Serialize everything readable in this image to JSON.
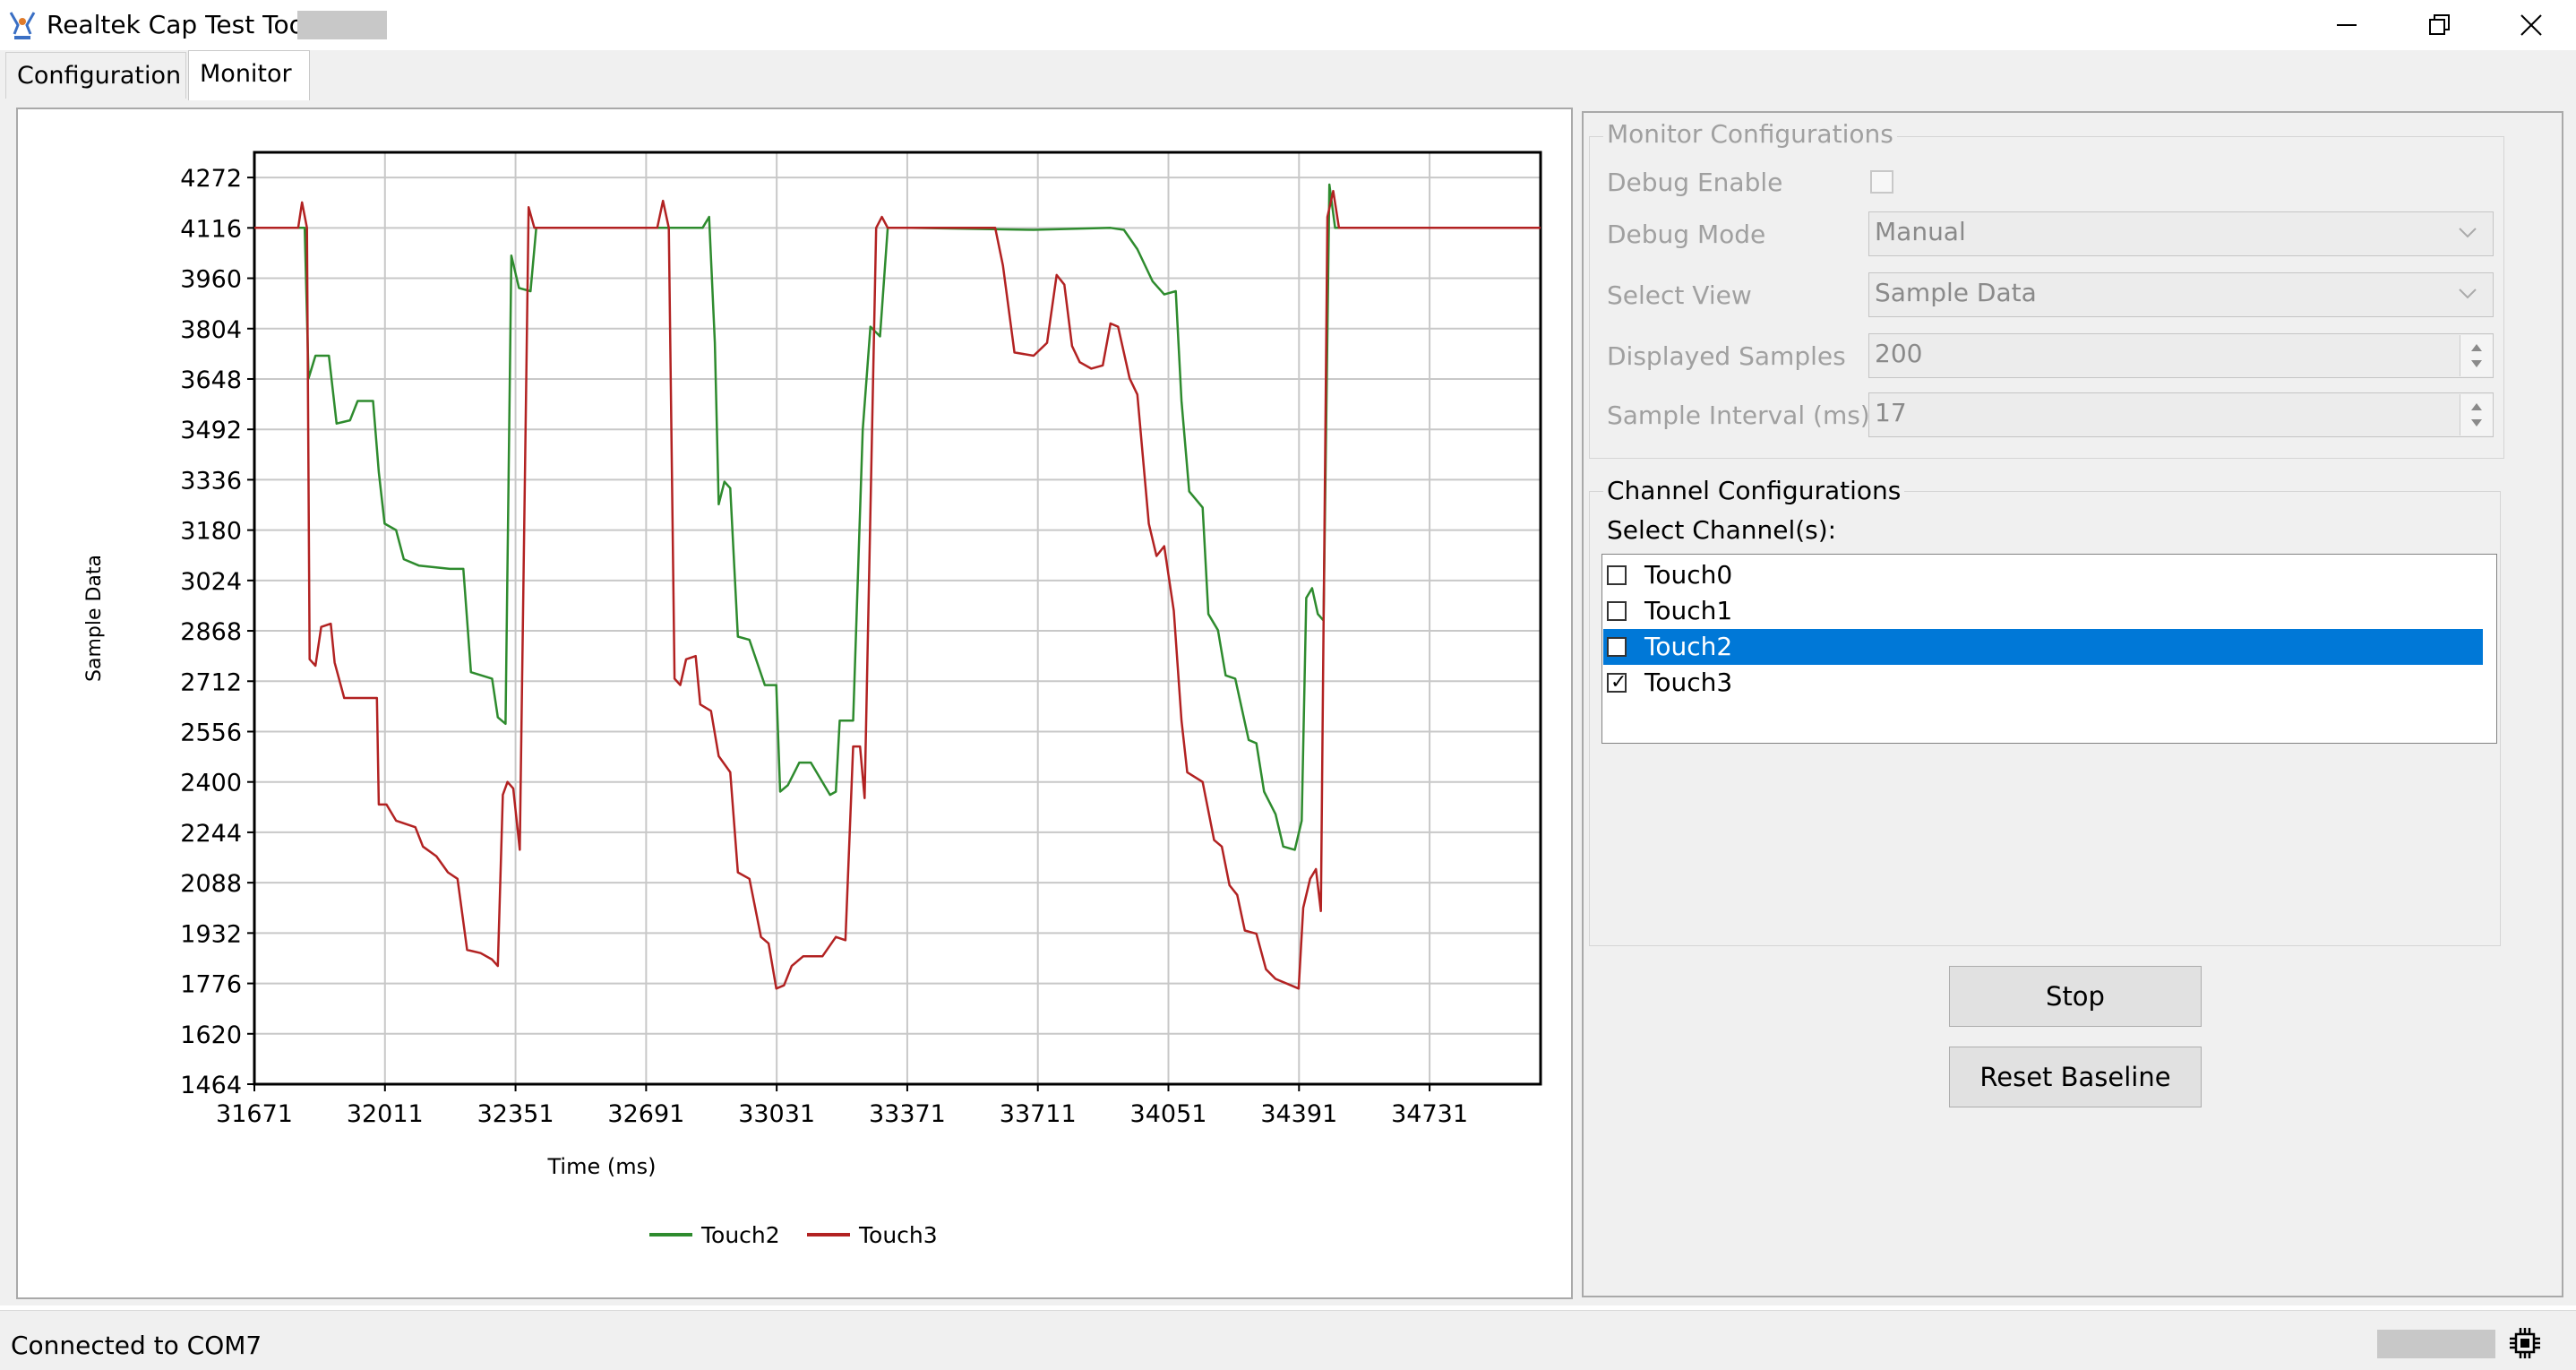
{
  "window": {
    "title": "Realtek Cap Test Tool",
    "controls": [
      "minimize-icon",
      "restore-icon",
      "close-icon"
    ]
  },
  "tabs": [
    {
      "label": "Configuration",
      "active": false
    },
    {
      "label": "Monitor",
      "active": true
    }
  ],
  "monitor_config": {
    "title": "Monitor Configurations",
    "debug_enable_label": "Debug Enable",
    "debug_enable_checked": false,
    "debug_mode_label": "Debug Mode",
    "debug_mode_value": "Manual",
    "select_view_label": "Select View",
    "select_view_value": "Sample Data",
    "displayed_samples_label": "Displayed Samples",
    "displayed_samples_value": "200",
    "sample_interval_label": "Sample Interval (ms)",
    "sample_interval_value": "17"
  },
  "channel_config": {
    "title": "Channel Configurations",
    "select_label": "Select Channel(s):",
    "channels": [
      {
        "label": "Touch0",
        "checked": false,
        "selected": false
      },
      {
        "label": "Touch1",
        "checked": false,
        "selected": false
      },
      {
        "label": "Touch2",
        "checked": true,
        "selected": true
      },
      {
        "label": "Touch3",
        "checked": true,
        "selected": false
      }
    ]
  },
  "buttons": {
    "stop": "Stop",
    "reset_baseline": "Reset Baseline"
  },
  "status": {
    "text": "Connected to COM7",
    "icon": "chip-icon"
  },
  "chart_data": {
    "type": "line",
    "xlabel": "Time (ms)",
    "ylabel": "Sample Data",
    "xlim": [
      31671,
      35020
    ],
    "ylim": [
      1464,
      4350
    ],
    "xticks": [
      31671,
      32011,
      32351,
      32691,
      33031,
      33371,
      33711,
      34051,
      34391,
      34731
    ],
    "yticks": [
      1464,
      1620,
      1776,
      1932,
      2088,
      2244,
      2400,
      2556,
      2712,
      2868,
      3024,
      3180,
      3336,
      3492,
      3648,
      3804,
      3960,
      4116,
      4272
    ],
    "grid": true,
    "legend_position": "bottom",
    "series": [
      {
        "name": "Touch2",
        "color": "#2e8b2e",
        "points": [
          [
            31671,
            4116
          ],
          [
            31792,
            4116
          ],
          [
            31802,
            4116
          ],
          [
            31812,
            3650
          ],
          [
            31830,
            3720
          ],
          [
            31865,
            3720
          ],
          [
            31885,
            3510
          ],
          [
            31920,
            3520
          ],
          [
            31940,
            3580
          ],
          [
            31980,
            3580
          ],
          [
            31995,
            3360
          ],
          [
            32010,
            3200
          ],
          [
            32040,
            3180
          ],
          [
            32060,
            3090
          ],
          [
            32100,
            3070
          ],
          [
            32180,
            3060
          ],
          [
            32215,
            3060
          ],
          [
            32235,
            2740
          ],
          [
            32290,
            2720
          ],
          [
            32305,
            2600
          ],
          [
            32325,
            2580
          ],
          [
            32340,
            4030
          ],
          [
            32360,
            3930
          ],
          [
            32390,
            3920
          ],
          [
            32405,
            4116
          ],
          [
            32820,
            4116
          ],
          [
            32838,
            4116
          ],
          [
            32855,
            4150
          ],
          [
            32870,
            3760
          ],
          [
            32880,
            3260
          ],
          [
            32895,
            3330
          ],
          [
            32910,
            3310
          ],
          [
            32930,
            2850
          ],
          [
            32960,
            2840
          ],
          [
            33000,
            2700
          ],
          [
            33030,
            2700
          ],
          [
            33040,
            2370
          ],
          [
            33060,
            2390
          ],
          [
            33090,
            2460
          ],
          [
            33120,
            2460
          ],
          [
            33170,
            2360
          ],
          [
            33185,
            2370
          ],
          [
            33195,
            2590
          ],
          [
            33230,
            2590
          ],
          [
            33255,
            3490
          ],
          [
            33275,
            3810
          ],
          [
            33300,
            3780
          ],
          [
            33320,
            4116
          ],
          [
            33380,
            4116
          ],
          [
            33700,
            4110
          ],
          [
            33900,
            4116
          ],
          [
            33935,
            4110
          ],
          [
            33970,
            4050
          ],
          [
            34010,
            3950
          ],
          [
            34040,
            3910
          ],
          [
            34070,
            3920
          ],
          [
            34085,
            3580
          ],
          [
            34105,
            3300
          ],
          [
            34140,
            3250
          ],
          [
            34155,
            2920
          ],
          [
            34180,
            2870
          ],
          [
            34200,
            2730
          ],
          [
            34225,
            2720
          ],
          [
            34260,
            2530
          ],
          [
            34280,
            2520
          ],
          [
            34300,
            2370
          ],
          [
            34330,
            2300
          ],
          [
            34350,
            2200
          ],
          [
            34380,
            2190
          ],
          [
            34398,
            2280
          ],
          [
            34410,
            2970
          ],
          [
            34425,
            3000
          ],
          [
            34440,
            2920
          ],
          [
            34455,
            2900
          ],
          [
            34470,
            4250
          ],
          [
            34485,
            4116
          ],
          [
            35020,
            4116
          ]
        ]
      },
      {
        "name": "Touch3",
        "color": "#b22222",
        "points": [
          [
            31671,
            4116
          ],
          [
            31785,
            4116
          ],
          [
            31795,
            4195
          ],
          [
            31808,
            4116
          ],
          [
            31815,
            2780
          ],
          [
            31830,
            2760
          ],
          [
            31845,
            2880
          ],
          [
            31870,
            2890
          ],
          [
            31880,
            2770
          ],
          [
            31905,
            2660
          ],
          [
            31950,
            2660
          ],
          [
            31990,
            2660
          ],
          [
            31995,
            2330
          ],
          [
            32015,
            2330
          ],
          [
            32040,
            2280
          ],
          [
            32090,
            2260
          ],
          [
            32110,
            2200
          ],
          [
            32145,
            2170
          ],
          [
            32175,
            2120
          ],
          [
            32200,
            2100
          ],
          [
            32225,
            1880
          ],
          [
            32260,
            1870
          ],
          [
            32290,
            1850
          ],
          [
            32305,
            1830
          ],
          [
            32318,
            2360
          ],
          [
            32330,
            2400
          ],
          [
            32345,
            2380
          ],
          [
            32362,
            2190
          ],
          [
            32385,
            4180
          ],
          [
            32400,
            4116
          ],
          [
            32720,
            4116
          ],
          [
            32735,
            4200
          ],
          [
            32750,
            4116
          ],
          [
            32765,
            2720
          ],
          [
            32780,
            2700
          ],
          [
            32795,
            2780
          ],
          [
            32820,
            2790
          ],
          [
            32832,
            2640
          ],
          [
            32860,
            2620
          ],
          [
            32880,
            2480
          ],
          [
            32910,
            2430
          ],
          [
            32930,
            2120
          ],
          [
            32960,
            2100
          ],
          [
            32990,
            1920
          ],
          [
            33010,
            1900
          ],
          [
            33030,
            1760
          ],
          [
            33050,
            1770
          ],
          [
            33070,
            1830
          ],
          [
            33100,
            1860
          ],
          [
            33150,
            1860
          ],
          [
            33185,
            1920
          ],
          [
            33210,
            1910
          ],
          [
            33230,
            2510
          ],
          [
            33248,
            2510
          ],
          [
            33260,
            2350
          ],
          [
            33290,
            4116
          ],
          [
            33305,
            4150
          ],
          [
            33320,
            4116
          ],
          [
            33600,
            4116
          ],
          [
            33620,
            4000
          ],
          [
            33650,
            3730
          ],
          [
            33700,
            3720
          ],
          [
            33735,
            3760
          ],
          [
            33760,
            3970
          ],
          [
            33780,
            3940
          ],
          [
            33800,
            3750
          ],
          [
            33820,
            3700
          ],
          [
            33850,
            3680
          ],
          [
            33880,
            3690
          ],
          [
            33900,
            3820
          ],
          [
            33920,
            3810
          ],
          [
            33950,
            3650
          ],
          [
            33970,
            3600
          ],
          [
            34000,
            3200
          ],
          [
            34020,
            3100
          ],
          [
            34040,
            3130
          ],
          [
            34065,
            2930
          ],
          [
            34085,
            2590
          ],
          [
            34100,
            2430
          ],
          [
            34140,
            2400
          ],
          [
            34170,
            2220
          ],
          [
            34190,
            2200
          ],
          [
            34210,
            2080
          ],
          [
            34230,
            2050
          ],
          [
            34250,
            1940
          ],
          [
            34280,
            1930
          ],
          [
            34305,
            1820
          ],
          [
            34330,
            1790
          ],
          [
            34370,
            1770
          ],
          [
            34390,
            1760
          ],
          [
            34402,
            2010
          ],
          [
            34420,
            2100
          ],
          [
            34435,
            2130
          ],
          [
            34448,
            2000
          ],
          [
            34465,
            4150
          ],
          [
            34480,
            4230
          ],
          [
            34495,
            4116
          ],
          [
            35020,
            4116
          ]
        ]
      }
    ]
  }
}
